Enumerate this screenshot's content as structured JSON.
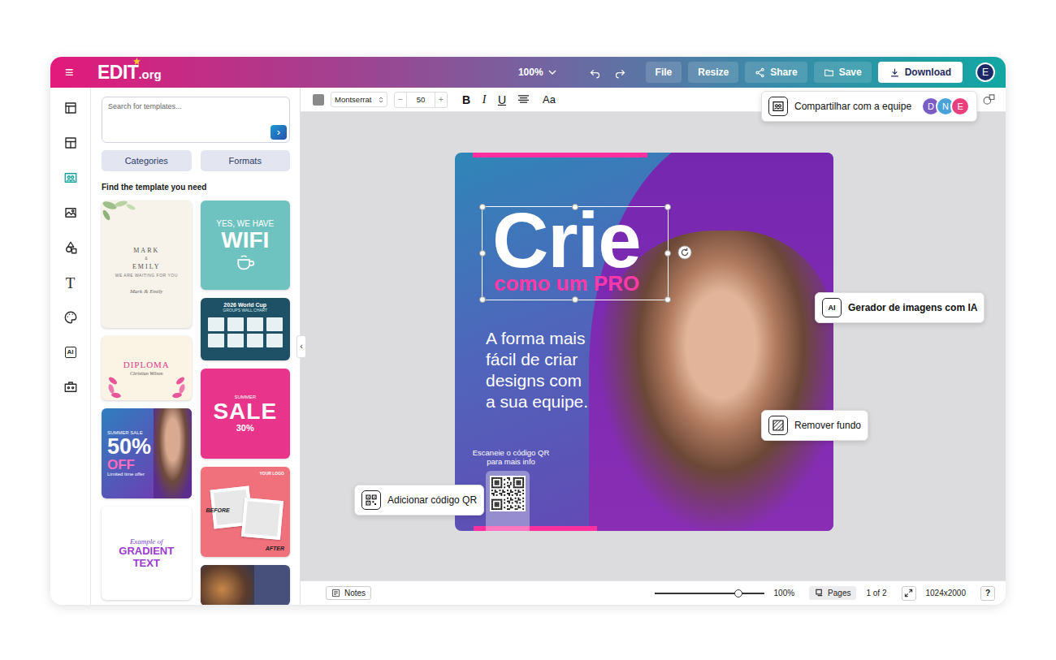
{
  "app": {
    "menu_icon": "≡",
    "logo": {
      "name": "EDIT",
      "suffix": ".org"
    }
  },
  "topbar": {
    "zoom": "100%",
    "buttons": [
      {
        "label": "File",
        "kind": "plain"
      },
      {
        "label": "Resize",
        "kind": "plain"
      },
      {
        "label": "Share",
        "kind": "share"
      },
      {
        "label": "Save",
        "kind": "save"
      },
      {
        "label": "Download",
        "kind": "download"
      }
    ],
    "user": "E"
  },
  "rail": [
    {
      "kind": "icon",
      "selected": false
    },
    {
      "kind": "icon",
      "selected": false
    },
    {
      "kind": "icon",
      "selected": true
    },
    {
      "kind": "icon",
      "selected": false
    },
    {
      "kind": "icon",
      "selected": false
    },
    {
      "kind": "text",
      "glyph": "T",
      "selected": false
    },
    {
      "kind": "icon",
      "selected": false
    },
    {
      "kind": "ai",
      "glyph": "AI",
      "selected": false
    },
    {
      "kind": "icon",
      "selected": false
    }
  ],
  "panel": {
    "search_placeholder": "Search for templates...",
    "search_button": "›",
    "tabs": [
      "Categories",
      "Formats"
    ],
    "heading": "Find the template you need",
    "template_columns": [
      [
        {
          "kind": "wedding",
          "lines": [
            {
              "text": "MARK",
              "kind": "name"
            },
            {
              "text": "&",
              "kind": "small"
            },
            {
              "text": "EMILY",
              "kind": "name"
            },
            {
              "text": "WE ARE WAITING FOR YOU",
              "kind": "small"
            },
            {
              "text": "Mark & Emily",
              "kind": "script"
            }
          ]
        },
        {
          "kind": "diploma",
          "lines": [
            {
              "text": "DIPLOMA",
              "kind": "title"
            },
            {
              "text": "Christian Wilson",
              "kind": "script"
            }
          ]
        },
        {
          "kind": "promo",
          "lines": [
            {
              "text": "SUMMER SALE",
              "kind": "small"
            },
            {
              "text": "50%",
              "kind": "big"
            },
            {
              "text": "OFF",
              "kind": "accent"
            },
            {
              "text": "Limited time offer",
              "kind": "small"
            }
          ]
        },
        {
          "kind": "gradient",
          "lines": [
            {
              "text": "Example of",
              "kind": "script"
            },
            {
              "text": "GRADIENT",
              "kind": "title"
            },
            {
              "text": "TEXT",
              "kind": "title"
            }
          ]
        }
      ],
      [
        {
          "kind": "wifi",
          "lines": [
            {
              "text": "YES, WE HAVE",
              "kind": "small"
            },
            {
              "text": "WIFI",
              "kind": "big"
            }
          ]
        },
        {
          "kind": "worldcup",
          "lines": [
            {
              "text": "2026 World Cup",
              "kind": "title"
            },
            {
              "text": "GROUPS WALL CHART",
              "kind": "small"
            }
          ]
        },
        {
          "kind": "sale",
          "lines": [
            {
              "text": "SUMMER",
              "kind": "small"
            },
            {
              "text": "SALE",
              "kind": "big"
            },
            {
              "text": "30%",
              "kind": "accent"
            }
          ]
        },
        {
          "kind": "beforeafter",
          "lines": [
            {
              "text": "YOUR LOGO",
              "kind": "small"
            },
            {
              "text": "BEFORE",
              "kind": "script"
            },
            {
              "text": "AFTER",
              "kind": "script"
            }
          ]
        },
        {
          "kind": "food",
          "lines": []
        }
      ]
    ]
  },
  "collapse_handle": "‹",
  "toolbar": {
    "font": "Montserrat",
    "size": "50",
    "minus": "−",
    "plus": "+",
    "bold": "B",
    "italic": "I",
    "underline": "U",
    "case": "Aa"
  },
  "design": {
    "title": "Crie",
    "subtitle": "como um PRO",
    "body": [
      "A forma mais",
      "fácil de criar",
      "designs com",
      "a sua equipe."
    ],
    "qr_caption": [
      "Escaneie o código QR",
      "para mais info"
    ]
  },
  "callouts": [
    {
      "label": "Compartilhar com a equipe",
      "kind": "share"
    },
    {
      "label": "Gerador de imagens com IA",
      "kind": "ai",
      "glyph": "AI"
    },
    {
      "label": "Remover fundo",
      "kind": "background"
    },
    {
      "label": "Adicionar código QR",
      "kind": "qr"
    }
  ],
  "team": [
    {
      "initial": "D",
      "color": "#7b5cc4"
    },
    {
      "initial": "N",
      "color": "#4aa3d8"
    },
    {
      "initial": "E",
      "color": "#e8407f"
    }
  ],
  "status_bar": {
    "notes": "Notes",
    "zoom": {
      "level": 0.77,
      "reading": "100%"
    },
    "pages": "Pages",
    "page_count": "1 of 2",
    "dimensions": "1024x2000",
    "help": "?"
  }
}
